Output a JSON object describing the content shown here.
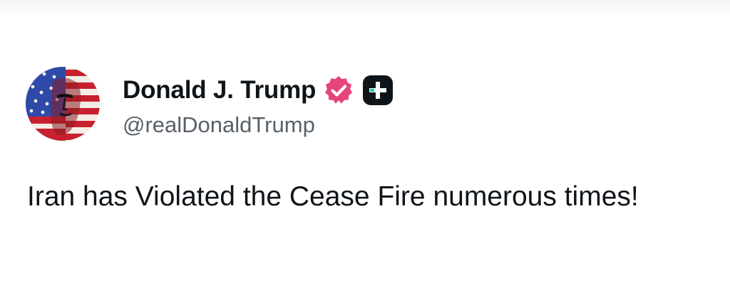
{
  "author": {
    "display_name": "Donald J. Trump",
    "handle": "@realDonaldTrump",
    "verified_icon": "verified-badge-icon",
    "secondary_badge_icon": "plus-badge-icon"
  },
  "post": {
    "text": "Iran has Violated the Cease Fire numerous times!"
  },
  "colors": {
    "verified_badge": "#e5457a",
    "plus_badge": "#0f1419",
    "text_primary": "#0f1419",
    "text_secondary": "#586069"
  }
}
